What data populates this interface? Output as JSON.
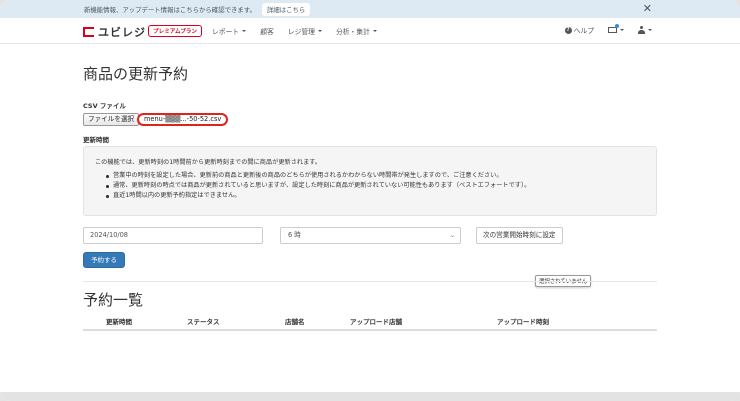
{
  "notice": {
    "text": "新機能情報、アップデート情報はこちらから確認できます。",
    "link_label": "詳細はこちら",
    "close_glyph": "✕"
  },
  "nav": {
    "logo_text": "ユビレジ",
    "premium_badge": "プレミアムプラン",
    "menu": [
      {
        "label": "レポート",
        "has_dropdown": true
      },
      {
        "label": "顧客",
        "has_dropdown": false
      },
      {
        "label": "レジ管理",
        "has_dropdown": true
      },
      {
        "label": "分析・集計",
        "has_dropdown": true
      }
    ],
    "help_label": "ヘルプ",
    "help_glyph": "?"
  },
  "page": {
    "title": "商品の更新予約",
    "csv_label": "CSV ファイル",
    "file_button_label": "ファイルを選択",
    "file_name": "menu-▒▒▒...-50-52.csv",
    "update_time_label": "更新時間",
    "info_main": "この機能では、更新時刻の1時間前から更新時刻までの間に商品が更新されます。",
    "info_items": [
      "営業中の時刻を設定した場合、更新前の商品と更新後の商品のどちらが使用されるかわからない時間帯が発生しますので、ご注意ください。",
      "通常、更新時刻の時点では商品が更新されていると思いますが、設定した時刻に商品が更新されていない可能性もあります（ベストエフォートです）。",
      "直近1時間以内の更新予約指定はできません。"
    ],
    "date_value": "2024/10/08",
    "hour_value": "6 時",
    "select_arrow": "⌄",
    "set_open_time_button": "次の営業開始時刻に設定",
    "reserve_button": "予約する",
    "tooltip": "選択されていません"
  },
  "reservations": {
    "title": "予約一覧",
    "columns": [
      "更新時間",
      "ステータス",
      "店舗名",
      "アップロード店舗",
      "アップロード時刻"
    ]
  },
  "colors": {
    "brand_red": "#d8001d",
    "primary_blue": "#337ab7",
    "notice_bg": "#dde9f3",
    "highlight_red": "#e0231c"
  }
}
